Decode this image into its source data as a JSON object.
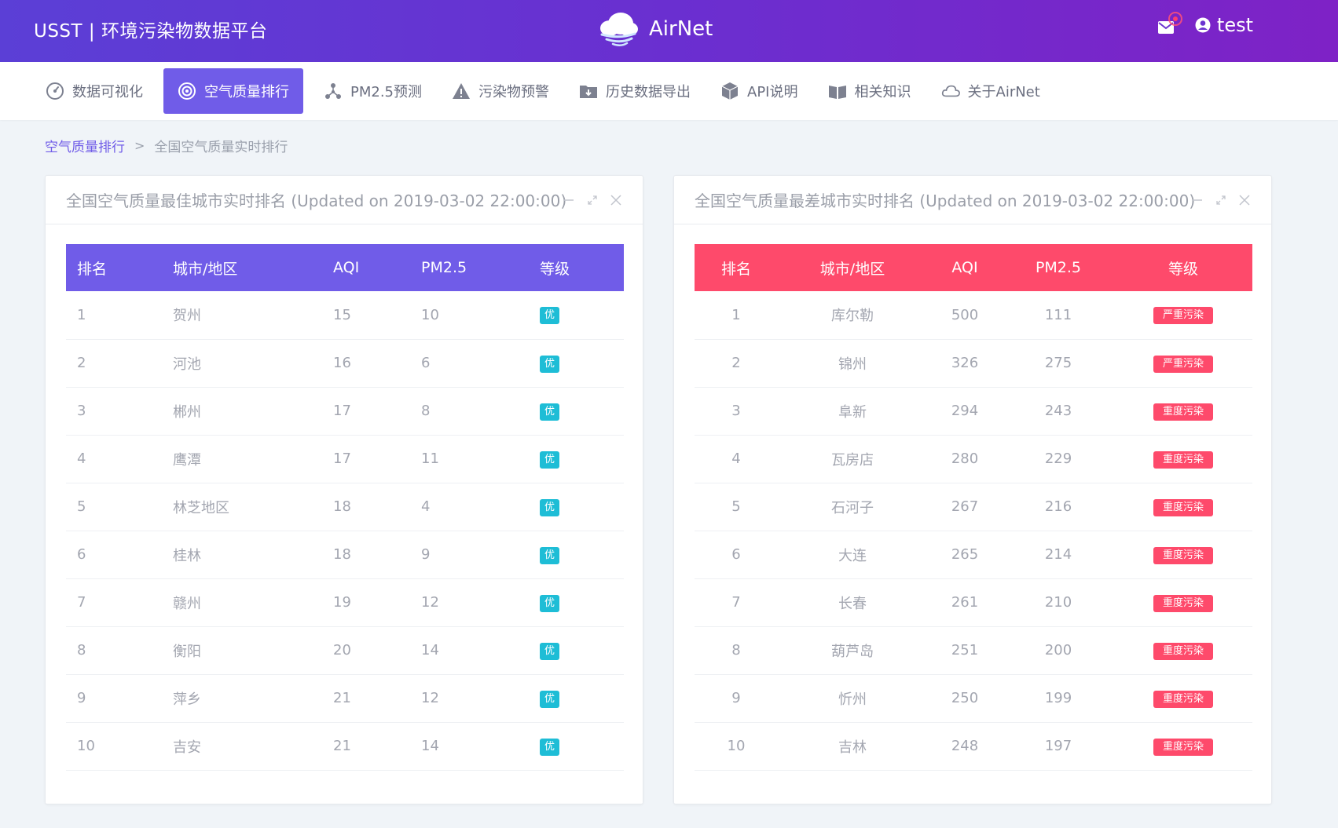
{
  "header": {
    "brand": "USST | 环境污染物数据平台",
    "logo_text": "AirNet",
    "user_name": "test"
  },
  "nav": {
    "items": [
      {
        "label": "数据可视化",
        "icon": "dashboard-icon"
      },
      {
        "label": "空气质量排行",
        "icon": "target-icon",
        "active": true
      },
      {
        "label": "PM2.5预测",
        "icon": "network-icon"
      },
      {
        "label": "污染物预警",
        "icon": "warning-icon"
      },
      {
        "label": "历史数据导出",
        "icon": "download-folder-icon"
      },
      {
        "label": "API说明",
        "icon": "cube-icon"
      },
      {
        "label": "相关知识",
        "icon": "book-icon"
      },
      {
        "label": "关于AirNet",
        "icon": "cloud-icon"
      }
    ]
  },
  "breadcrumb": {
    "parent": "空气质量排行",
    "separator": ">",
    "current": "全国空气质量实时排行"
  },
  "best_panel": {
    "title": "全国空气质量最佳城市实时排名 (Updated on 2019-03-02 22:00:00)",
    "columns": [
      "排名",
      "城市/地区",
      "AQI",
      "PM2.5",
      "等级"
    ],
    "rows": [
      [
        "1",
        "贺州",
        "15",
        "10",
        "优"
      ],
      [
        "2",
        "河池",
        "16",
        "6",
        "优"
      ],
      [
        "3",
        "郴州",
        "17",
        "8",
        "优"
      ],
      [
        "4",
        "鹰潭",
        "17",
        "11",
        "优"
      ],
      [
        "5",
        "林芝地区",
        "18",
        "4",
        "优"
      ],
      [
        "6",
        "桂林",
        "18",
        "9",
        "优"
      ],
      [
        "7",
        "赣州",
        "19",
        "12",
        "优"
      ],
      [
        "8",
        "衡阳",
        "20",
        "14",
        "优"
      ],
      [
        "9",
        "萍乡",
        "21",
        "12",
        "优"
      ],
      [
        "10",
        "吉安",
        "21",
        "14",
        "优"
      ]
    ]
  },
  "worst_panel": {
    "title": "全国空气质量最差城市实时排名 (Updated on 2019-03-02 22:00:00)",
    "columns": [
      "排名",
      "城市/地区",
      "AQI",
      "PM2.5",
      "等级"
    ],
    "rows": [
      [
        "1",
        "库尔勒",
        "500",
        "111",
        "严重污染"
      ],
      [
        "2",
        "锦州",
        "326",
        "275",
        "严重污染"
      ],
      [
        "3",
        "阜新",
        "294",
        "243",
        "重度污染"
      ],
      [
        "4",
        "瓦房店",
        "280",
        "229",
        "重度污染"
      ],
      [
        "5",
        "石河子",
        "267",
        "216",
        "重度污染"
      ],
      [
        "6",
        "大连",
        "265",
        "214",
        "重度污染"
      ],
      [
        "7",
        "长春",
        "261",
        "210",
        "重度污染"
      ],
      [
        "8",
        "葫芦岛",
        "251",
        "200",
        "重度污染"
      ],
      [
        "9",
        "忻州",
        "250",
        "199",
        "重度污染"
      ],
      [
        "10",
        "吉林",
        "248",
        "197",
        "重度污染"
      ]
    ]
  },
  "colors": {
    "accent": "#705ce8",
    "danger": "#fe4a6b",
    "good_badge": "#1ebdd6"
  }
}
